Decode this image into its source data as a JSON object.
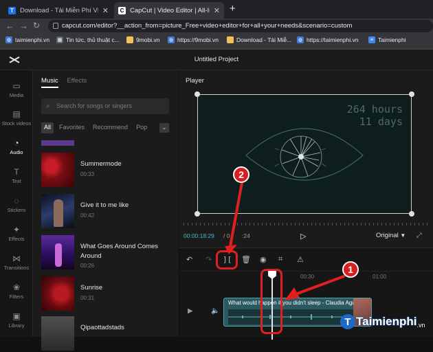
{
  "browser": {
    "tabs": [
      {
        "title": "Download - Tải Miễn Phí VN - Ph",
        "favicon_color": "#1a73e8",
        "favicon_glyph": "T"
      },
      {
        "title": "CapCut | Video Editor | All-In-On",
        "favicon_color": "#ffffff",
        "favicon_glyph": "C"
      }
    ],
    "new_tab": "+",
    "url": "capcut.com/editor?__action_from=picture_Free+video+editor+for+all+your+needs&scenario=custom",
    "bookmarks": [
      {
        "label": "taimienphi.vn",
        "icon": "globe-icon",
        "color": "#3d79d8"
      },
      {
        "label": "Tin tức, thủ thuật c...",
        "icon": "news-icon",
        "color": "#5f6368"
      },
      {
        "label": "9mobi.vn",
        "icon": "folder-icon",
        "color": "#f2c15b"
      },
      {
        "label": "https://9mobi.vn",
        "icon": "globe-icon",
        "color": "#3d79d8"
      },
      {
        "label": "Download - Tải Miễ...",
        "icon": "folder-icon",
        "color": "#f2c15b"
      },
      {
        "label": "https://taimienphi.vn",
        "icon": "globe-icon",
        "color": "#3d79d8"
      },
      {
        "label": "Taimienphi",
        "icon": "doc-icon",
        "color": "#4285f4"
      }
    ]
  },
  "app": {
    "project_title": "Untitled Project",
    "nav": [
      {
        "label": "Media",
        "icon": "media-icon",
        "glyph": "▭"
      },
      {
        "label": "Stock videos",
        "icon": "stock-videos-icon",
        "glyph": "▤"
      },
      {
        "label": "Audio",
        "icon": "audio-icon",
        "glyph": "◔"
      },
      {
        "label": "Text",
        "icon": "text-icon",
        "glyph": "T"
      },
      {
        "label": "Stickers",
        "icon": "stickers-icon",
        "glyph": "◌"
      },
      {
        "label": "Effects",
        "icon": "effects-icon",
        "glyph": "✦"
      },
      {
        "label": "Transitions",
        "icon": "transitions-icon",
        "glyph": "⋈"
      },
      {
        "label": "Filters",
        "icon": "filters-icon",
        "glyph": "❀"
      },
      {
        "label": "Library",
        "icon": "library-icon",
        "glyph": "▣"
      }
    ],
    "nav_selected": "Audio"
  },
  "panel": {
    "tabs": [
      "Music",
      "Effects"
    ],
    "search_placeholder": "Search for songs or singers",
    "categories": [
      "All",
      "Favorites",
      "Recommend",
      "Pop"
    ],
    "songs": [
      {
        "title": "Summermode",
        "duration": "00:33",
        "color": "#7a0d12"
      },
      {
        "title": "Give it to me like",
        "duration": "00:42",
        "color": "#1f2a4a"
      },
      {
        "title": "What Goes Around Comes Around",
        "duration": "00:26",
        "color": "#3a1a66"
      },
      {
        "title": "Sunrise",
        "duration": "00:31",
        "color": "#6e0c10"
      },
      {
        "title": "Qipaottadstads",
        "duration": "",
        "color": "#3c3c3c"
      }
    ]
  },
  "player": {
    "label": "Player",
    "overlay_line1": "264 hours",
    "overlay_line2": "11 days",
    "time_current": "00:00:18:29",
    "time_total_suffix": "/ 0",
    "time_total_tail": ":24",
    "ratio": "Original"
  },
  "timeline": {
    "tools": [
      "undo-icon",
      "redo-icon",
      "split-icon",
      "delete-icon",
      "record-icon",
      "crop-icon",
      "triangle-icon"
    ],
    "ruler": [
      "00:30",
      "01:00"
    ],
    "clip_name": "What would happen if you didn't sleep - Claudia Aguirre"
  },
  "annotations": [
    {
      "number": "1",
      "color": "#d61f1f"
    },
    {
      "number": "2",
      "color": "#d61f1f"
    }
  ],
  "watermark": {
    "name": "Taimienphi",
    "suffix": ".vn"
  }
}
